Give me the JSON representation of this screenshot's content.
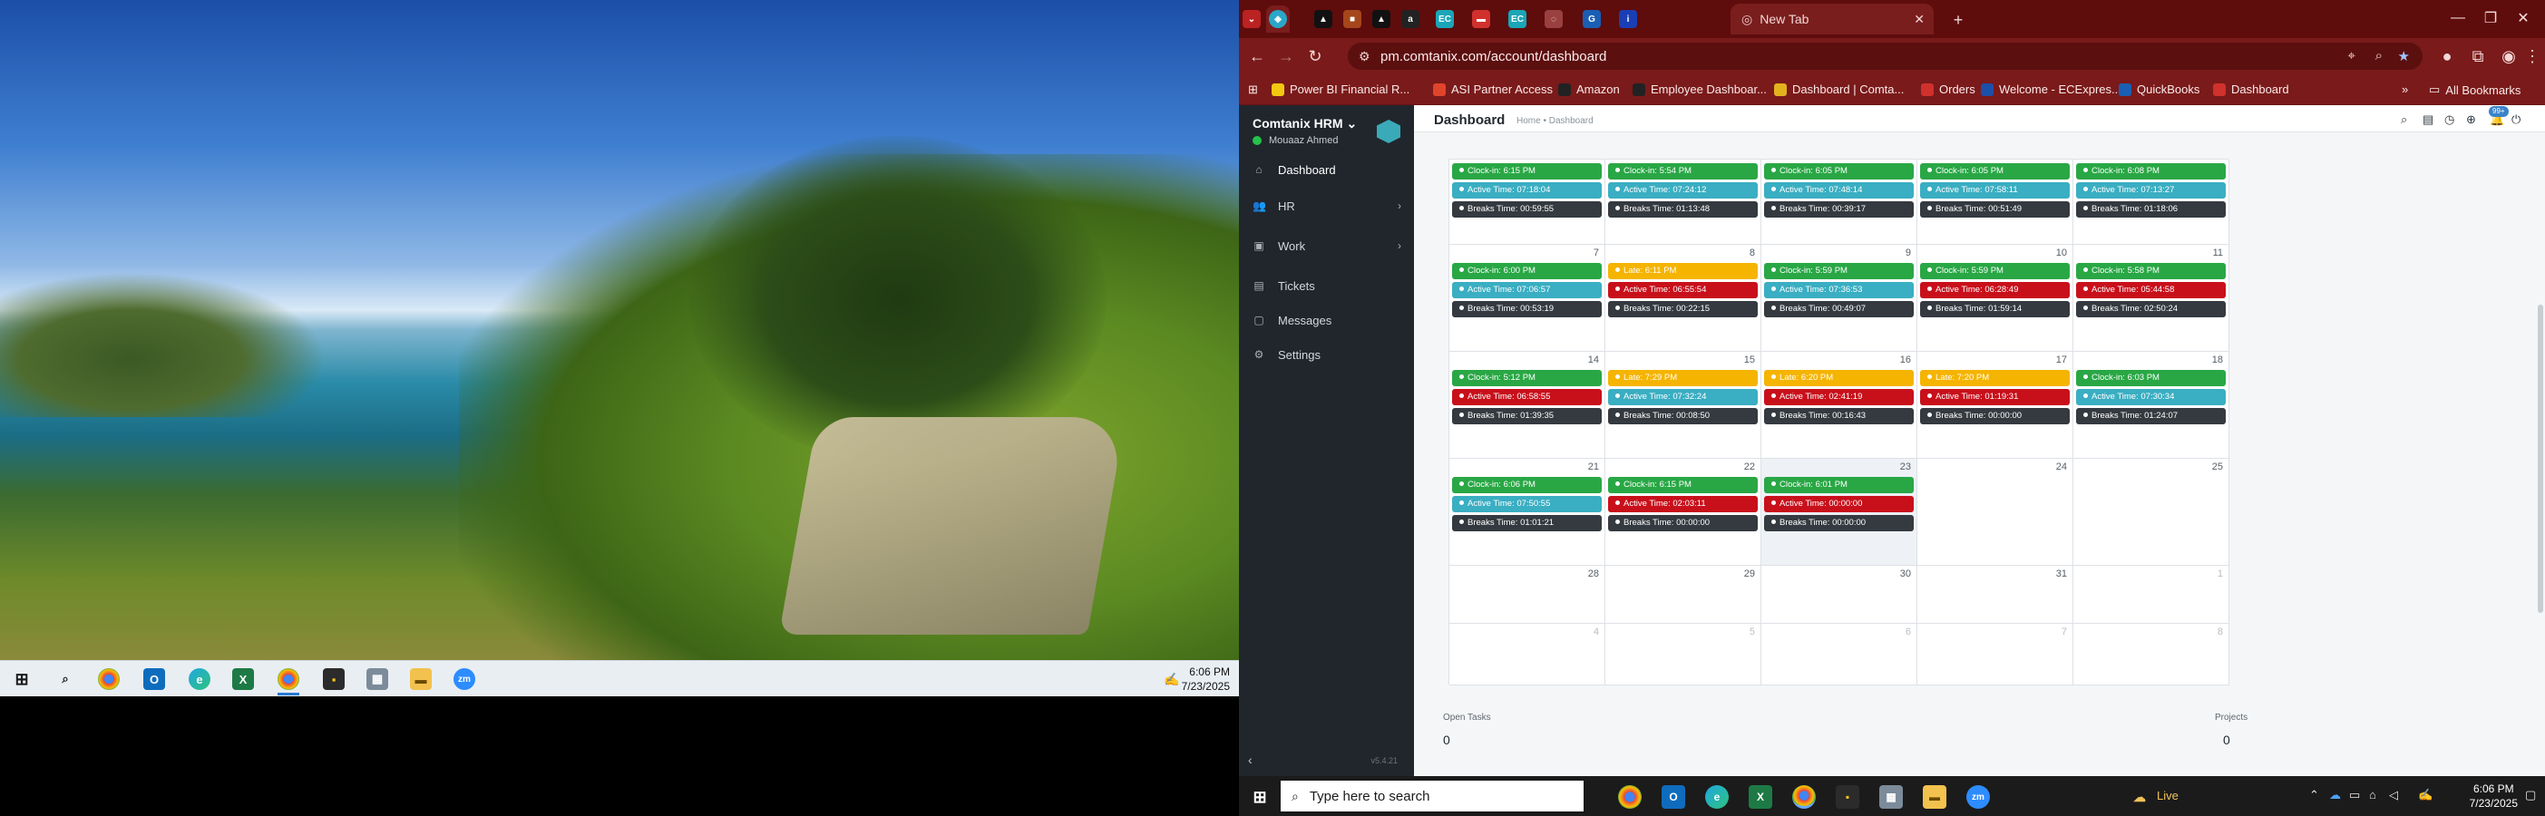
{
  "left_screen": {
    "taskbar": {
      "icons": [
        "windows-start-icon",
        "search-icon",
        "chrome-icon",
        "outlook-icon",
        "edge-icon",
        "excel-icon",
        "chrome-active-icon",
        "sticky-notes-icon",
        "calculator-icon",
        "file-explorer-icon",
        "zoom-icon"
      ],
      "zoom_label": "zm",
      "time": "6:06 PM",
      "date": "7/23/2025"
    }
  },
  "browser": {
    "tabs": {
      "new_tab_label": "New Tab"
    },
    "url": "pm.comtanix.com/account/dashboard",
    "bookmarks": [
      {
        "label": "Power BI Financial R...",
        "color": "#f2c811"
      },
      {
        "label": "ASI Partner Access",
        "color": "#e0442c"
      },
      {
        "label": "Amazon",
        "color": "#222222"
      },
      {
        "label": "Employee Dashboar...",
        "color": "#222222"
      },
      {
        "label": "Dashboard | Comta...",
        "color": "#e3b21f"
      },
      {
        "label": "Orders",
        "color": "#d0312d"
      },
      {
        "label": "Welcome - ECExpres...",
        "color": "#1b4fa8"
      },
      {
        "label": "QuickBooks",
        "color": "#1a5fb4"
      },
      {
        "label": "Dashboard",
        "color": "#d0312d"
      }
    ],
    "all_bookmarks": "All Bookmarks"
  },
  "app": {
    "brand": "Comtanix HRM",
    "user": "Mouaaz Ahmed",
    "nav": [
      {
        "label": "Dashboard",
        "icon": "home-icon"
      },
      {
        "label": "HR",
        "icon": "users-icon"
      },
      {
        "label": "Work",
        "icon": "briefcase-icon"
      },
      {
        "label": "Tickets",
        "icon": "ticket-icon"
      },
      {
        "label": "Messages",
        "icon": "message-icon"
      },
      {
        "label": "Settings",
        "icon": "gear-icon"
      }
    ],
    "version": "v5.4.21",
    "page_title": "Dashboard",
    "breadcrumb": "Home • Dashboard",
    "notif_count": "99+",
    "open_tasks_label": "Open Tasks",
    "open_tasks_value": "0",
    "projects_label": "Projects",
    "projects_value": "0"
  },
  "calendar": {
    "weeks": [
      [
        {
          "day": "",
          "events": [
            [
              "green",
              "Clock-in: 6:15 PM"
            ],
            [
              "teal",
              "Active Time: 07:18:04"
            ],
            [
              "dark",
              "Breaks Time: 00:59:55"
            ]
          ]
        },
        {
          "day": "",
          "events": [
            [
              "green",
              "Clock-in: 5:54 PM"
            ],
            [
              "teal",
              "Active Time: 07:24:12"
            ],
            [
              "dark",
              "Breaks Time: 01:13:48"
            ]
          ]
        },
        {
          "day": "",
          "events": [
            [
              "green",
              "Clock-in: 6:05 PM"
            ],
            [
              "teal",
              "Active Time: 07:48:14"
            ],
            [
              "dark",
              "Breaks Time: 00:39:17"
            ]
          ]
        },
        {
          "day": "",
          "events": [
            [
              "green",
              "Clock-in: 6:05 PM"
            ],
            [
              "teal",
              "Active Time: 07:58:11"
            ],
            [
              "dark",
              "Breaks Time: 00:51:49"
            ]
          ]
        },
        {
          "day": "",
          "events": [
            [
              "green",
              "Clock-in: 6:08 PM"
            ],
            [
              "teal",
              "Active Time: 07:13:27"
            ],
            [
              "dark",
              "Breaks Time: 01:18:06"
            ]
          ]
        }
      ],
      [
        {
          "day": "7",
          "events": [
            [
              "green",
              "Clock-in: 6:00 PM"
            ],
            [
              "teal",
              "Active Time: 07:06:57"
            ],
            [
              "dark",
              "Breaks Time: 00:53:19"
            ]
          ]
        },
        {
          "day": "8",
          "events": [
            [
              "yellow",
              "Late: 6:11 PM"
            ],
            [
              "red",
              "Active Time: 06:55:54"
            ],
            [
              "dark",
              "Breaks Time: 00:22:15"
            ]
          ]
        },
        {
          "day": "9",
          "events": [
            [
              "green",
              "Clock-in: 5:59 PM"
            ],
            [
              "teal",
              "Active Time: 07:36:53"
            ],
            [
              "dark",
              "Breaks Time: 00:49:07"
            ]
          ]
        },
        {
          "day": "10",
          "events": [
            [
              "green",
              "Clock-in: 5:59 PM"
            ],
            [
              "red",
              "Active Time: 06:28:49"
            ],
            [
              "dark",
              "Breaks Time: 01:59:14"
            ]
          ]
        },
        {
          "day": "11",
          "events": [
            [
              "green",
              "Clock-in: 5:58 PM"
            ],
            [
              "red",
              "Active Time: 05:44:58"
            ],
            [
              "dark",
              "Breaks Time: 02:50:24"
            ]
          ]
        }
      ],
      [
        {
          "day": "14",
          "events": [
            [
              "green",
              "Clock-in: 5:12 PM"
            ],
            [
              "red",
              "Active Time: 06:58:55"
            ],
            [
              "dark",
              "Breaks Time: 01:39:35"
            ]
          ]
        },
        {
          "day": "15",
          "events": [
            [
              "yellow",
              "Late: 7:29 PM"
            ],
            [
              "teal",
              "Active Time: 07:32:24"
            ],
            [
              "dark",
              "Breaks Time: 00:08:50"
            ]
          ]
        },
        {
          "day": "16",
          "events": [
            [
              "yellow",
              "Late: 6:20 PM"
            ],
            [
              "red",
              "Active Time: 02:41:19"
            ],
            [
              "dark",
              "Breaks Time: 00:16:43"
            ]
          ]
        },
        {
          "day": "17",
          "events": [
            [
              "yellow",
              "Late: 7:20 PM"
            ],
            [
              "red",
              "Active Time: 01:19:31"
            ],
            [
              "dark",
              "Breaks Time: 00:00:00"
            ]
          ]
        },
        {
          "day": "18",
          "events": [
            [
              "green",
              "Clock-in: 6:03 PM"
            ],
            [
              "teal",
              "Active Time: 07:30:34"
            ],
            [
              "dark",
              "Breaks Time: 01:24:07"
            ]
          ]
        }
      ],
      [
        {
          "day": "21",
          "events": [
            [
              "green",
              "Clock-in: 6:06 PM"
            ],
            [
              "teal",
              "Active Time: 07:50:55"
            ],
            [
              "dark",
              "Breaks Time: 01:01:21"
            ]
          ]
        },
        {
          "day": "22",
          "events": [
            [
              "green",
              "Clock-in: 6:15 PM"
            ],
            [
              "red",
              "Active Time: 02:03:11"
            ],
            [
              "dark",
              "Breaks Time: 00:00:00"
            ]
          ]
        },
        {
          "day": "23",
          "today": true,
          "events": [
            [
              "green",
              "Clock-in: 6:01 PM"
            ],
            [
              "red",
              "Active Time: 00:00:00"
            ],
            [
              "dark",
              "Breaks Time: 00:00:00"
            ]
          ]
        },
        {
          "day": "24",
          "events": []
        },
        {
          "day": "25",
          "events": []
        }
      ],
      [
        {
          "day": "28",
          "events": []
        },
        {
          "day": "29",
          "events": []
        },
        {
          "day": "30",
          "events": []
        },
        {
          "day": "31",
          "events": []
        },
        {
          "day": "1",
          "other": true,
          "events": []
        }
      ],
      [
        {
          "day": "4",
          "other": true,
          "events": []
        },
        {
          "day": "5",
          "other": true,
          "events": []
        },
        {
          "day": "6",
          "other": true,
          "events": []
        },
        {
          "day": "7",
          "other": true,
          "events": []
        },
        {
          "day": "8",
          "other": true,
          "events": []
        }
      ]
    ]
  },
  "right_taskbar": {
    "search_placeholder": "Type here to search",
    "zoom_label": "zm",
    "live": "Live",
    "time": "6:06 PM",
    "date": "7/23/2025"
  }
}
